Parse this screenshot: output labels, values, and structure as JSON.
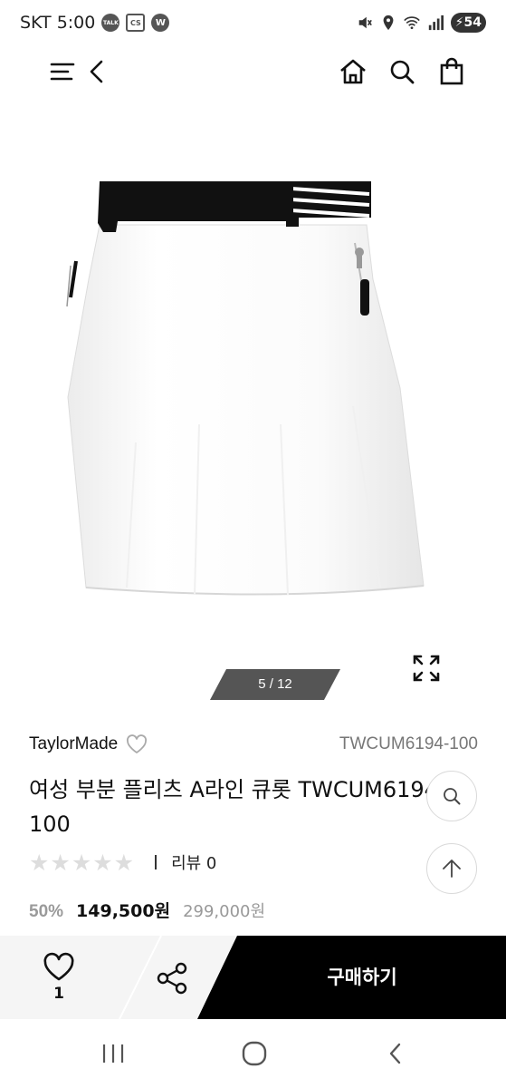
{
  "status_bar": {
    "carrier_time": "SKT 5:00",
    "badges": [
      "TALK",
      "CS",
      "W"
    ],
    "battery": "54"
  },
  "nav": {
    "icons": [
      "menu-icon",
      "back-icon",
      "home-icon",
      "search-icon",
      "shopping-bag-icon"
    ]
  },
  "gallery": {
    "page_indicator": "5 / 12",
    "current_page": 5,
    "total_pages": 12
  },
  "product": {
    "brand": "TaylorMade",
    "code": "TWCUM6194-100",
    "title": "여성 부분 플리츠 A라인 큐롯 TWCUM6194-100",
    "rating": 0,
    "rating_max": 5,
    "review_label": "리뷰 0",
    "discount": "50%",
    "sale_price": "149,500원",
    "original_price": "299,000원"
  },
  "bottom_bar": {
    "like_count": "1",
    "buy_label": "구매하기"
  },
  "colors": {
    "buy_button": "#000000",
    "page_indicator": "#555555",
    "bottom_bar_bg": "#f5f5f5"
  }
}
